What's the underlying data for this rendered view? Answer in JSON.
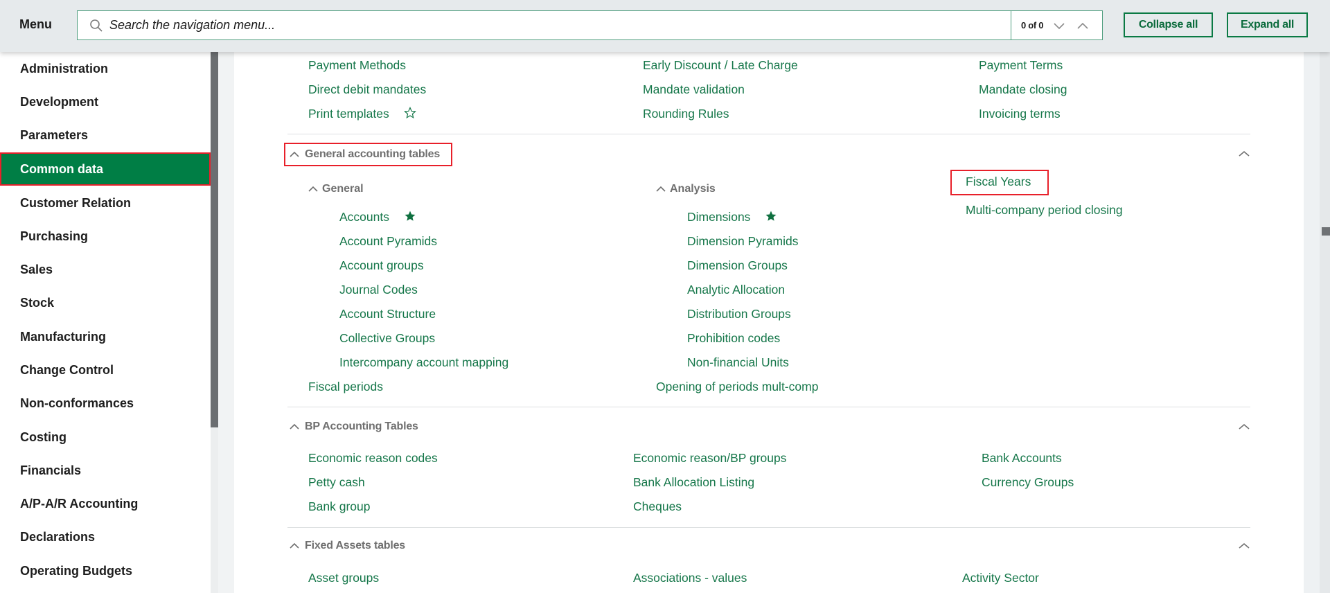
{
  "topbar": {
    "menu_title": "Menu",
    "search_placeholder": "Search the navigation menu...",
    "search_value": "",
    "search_count": "0 of 0",
    "collapse_all": "Collapse all",
    "expand_all": "Expand all",
    "icons": {
      "search": "search-icon",
      "next": "chevron-down-icon",
      "prev": "chevron-up-icon"
    }
  },
  "sidebar": {
    "items": [
      {
        "label": "Administration",
        "active": false
      },
      {
        "label": "Development",
        "active": false
      },
      {
        "label": "Parameters",
        "active": false
      },
      {
        "label": "Common data",
        "active": true
      },
      {
        "label": "Customer Relation",
        "active": false
      },
      {
        "label": "Purchasing",
        "active": false
      },
      {
        "label": "Sales",
        "active": false
      },
      {
        "label": "Stock",
        "active": false
      },
      {
        "label": "Manufacturing",
        "active": false
      },
      {
        "label": "Change Control",
        "active": false
      },
      {
        "label": "Non-conformances",
        "active": false
      },
      {
        "label": "Costing",
        "active": false
      },
      {
        "label": "Financials",
        "active": false
      },
      {
        "label": "A/P-A/R Accounting",
        "active": false
      },
      {
        "label": "Declarations",
        "active": false
      },
      {
        "label": "Operating Budgets",
        "active": false
      }
    ],
    "active_color": "#007e45"
  },
  "content": {
    "top_partial": {
      "col1": [
        "Payment Methods",
        "Direct debit mandates",
        "Print templates"
      ],
      "col2": [
        "Early Discount / Late Charge",
        "Mandate validation",
        "Rounding Rules"
      ],
      "col3": [
        "Payment Terms",
        "Mandate closing",
        "Invoicing terms"
      ],
      "favorite_outline": "Print templates"
    },
    "general_accounting": {
      "title": "General accounting tables",
      "general": {
        "title": "General",
        "items": [
          "Accounts",
          "Account Pyramids",
          "Account groups",
          "Journal Codes",
          "Account Structure",
          "Collective Groups",
          "Intercompany account mapping"
        ],
        "favorite": "Accounts"
      },
      "fiscal_periods": "Fiscal periods",
      "analysis": {
        "title": "Analysis",
        "items": [
          "Dimensions",
          "Dimension Pyramids",
          "Dimension Groups",
          "Analytic Allocation",
          "Distribution Groups",
          "Prohibition codes",
          "Non-financial Units"
        ],
        "favorite": "Dimensions"
      },
      "opening_periods": "Opening of periods mult-comp",
      "col3": [
        "Fiscal Years",
        "Multi-company period closing"
      ]
    },
    "bp_accounting": {
      "title": "BP Accounting Tables",
      "col1": [
        "Economic reason codes",
        "Petty cash",
        "Bank group"
      ],
      "col2": [
        "Economic reason/BP groups",
        "Bank Allocation Listing",
        "Cheques"
      ],
      "col3": [
        "Bank Accounts",
        "Currency Groups"
      ]
    },
    "fixed_assets": {
      "title": "Fixed Assets tables",
      "col1": [
        "Asset groups"
      ],
      "col2": [
        "Associations - values"
      ],
      "col3": [
        "Activity Sector"
      ]
    },
    "link_color": "#16774a",
    "highlight_color": "#e8202a"
  }
}
